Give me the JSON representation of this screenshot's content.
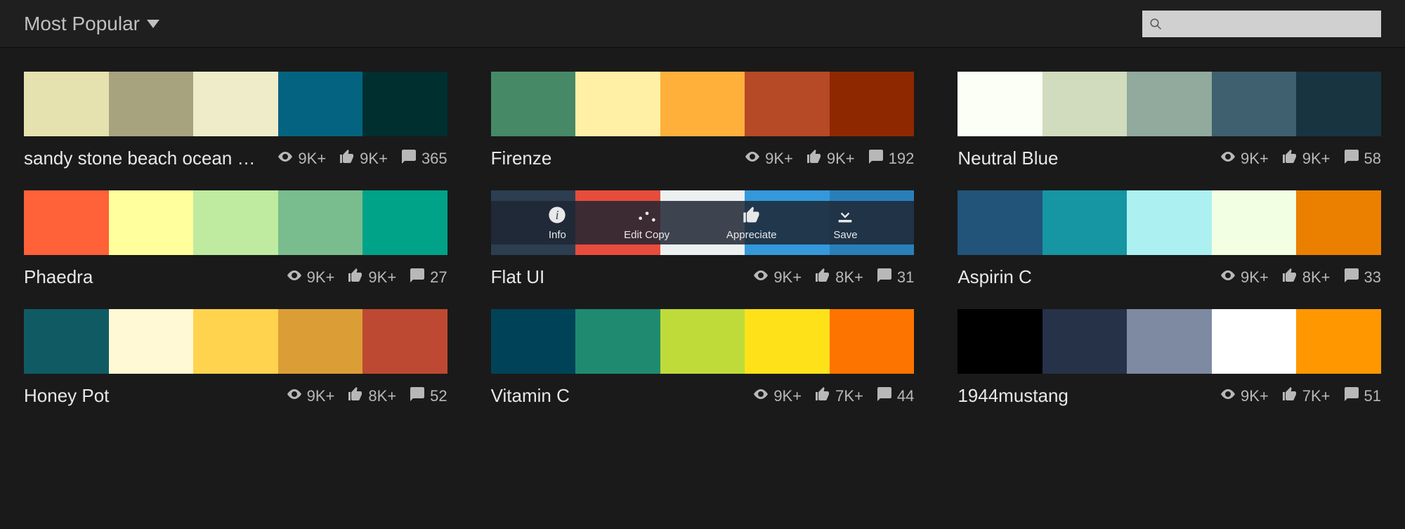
{
  "topbar": {
    "sort_label": "Most Popular",
    "search_placeholder": ""
  },
  "overlay_labels": {
    "info": "Info",
    "edit_copy": "Edit Copy",
    "appreciate": "Appreciate",
    "save": "Save"
  },
  "palettes": [
    {
      "name": "sandy stone beach ocean …",
      "colors": [
        "#E6E2AF",
        "#A7A37E",
        "#EFECCA",
        "#046380",
        "#002F2F"
      ],
      "views": "9K+",
      "likes": "9K+",
      "comments": "365",
      "hover": false
    },
    {
      "name": "Firenze",
      "colors": [
        "#468966",
        "#FFF0A5",
        "#FFB03B",
        "#B64926",
        "#8E2800"
      ],
      "views": "9K+",
      "likes": "9K+",
      "comments": "192",
      "hover": false
    },
    {
      "name": "Neutral Blue",
      "colors": [
        "#FCFFF5",
        "#D1DBBD",
        "#91AA9D",
        "#3E606F",
        "#193441"
      ],
      "views": "9K+",
      "likes": "9K+",
      "comments": "58",
      "hover": false
    },
    {
      "name": "Phaedra",
      "colors": [
        "#FF6138",
        "#FFFF9D",
        "#BEEB9F",
        "#79BD8F",
        "#00A388"
      ],
      "views": "9K+",
      "likes": "9K+",
      "comments": "27",
      "hover": false
    },
    {
      "name": "Flat UI",
      "colors": [
        "#2C3E50",
        "#E74C3C",
        "#ECF0F1",
        "#3498DB",
        "#2980B9"
      ],
      "views": "9K+",
      "likes": "8K+",
      "comments": "31",
      "hover": true
    },
    {
      "name": "Aspirin C",
      "colors": [
        "#225378",
        "#1695A3",
        "#ACF0F2",
        "#F3FFE2",
        "#EB7F00"
      ],
      "views": "9K+",
      "likes": "8K+",
      "comments": "33",
      "hover": false
    },
    {
      "name": "Honey Pot",
      "colors": [
        "#105B63",
        "#FFFAD5",
        "#FFD34E",
        "#DB9E36",
        "#BD4932"
      ],
      "views": "9K+",
      "likes": "8K+",
      "comments": "52",
      "hover": false
    },
    {
      "name": "Vitamin C",
      "colors": [
        "#004358",
        "#1F8A70",
        "#BEDB39",
        "#FFE11A",
        "#FD7400"
      ],
      "views": "9K+",
      "likes": "7K+",
      "comments": "44",
      "hover": false
    },
    {
      "name": "1944mustang",
      "colors": [
        "#000000",
        "#263248",
        "#7E8AA2",
        "#FFFFFF",
        "#FF9800"
      ],
      "views": "9K+",
      "likes": "7K+",
      "comments": "51",
      "hover": false
    }
  ]
}
